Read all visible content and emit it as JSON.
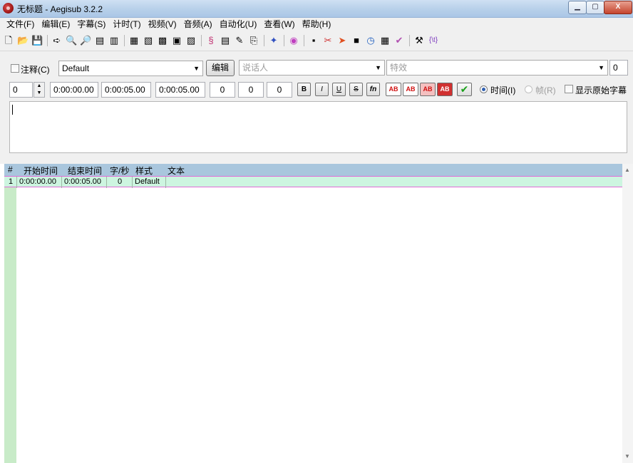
{
  "window": {
    "title": "无标题 - Aegisub 3.2.2",
    "min": "▁",
    "max": "▢",
    "close": "X"
  },
  "menu": [
    "文件(F)",
    "编辑(E)",
    "字幕(S)",
    "计时(T)",
    "视频(V)",
    "音频(A)",
    "自动化(U)",
    "查看(W)",
    "帮助(H)"
  ],
  "edit": {
    "comment_label": "注释(C)",
    "style": "Default",
    "edit_button": "编辑",
    "actor_placeholder": "说话人",
    "effect_placeholder": "特效",
    "layer": "0",
    "start": "0:00:00.00",
    "end": "0:00:05.00",
    "duration": "0:00:05.00",
    "margin_l": "0",
    "margin_r": "0",
    "margin_v": "0",
    "effect_num": "0",
    "bold": "B",
    "italic": "I",
    "underline": "U",
    "strike": "S",
    "fn": "fn",
    "ab1": "AB",
    "ab2": "AB",
    "ab3": "AB",
    "ab4": "AB",
    "time_radio": "时间(I)",
    "frame_radio": "帧(R)",
    "show_original": "显示原始字幕"
  },
  "grid": {
    "headers": [
      "#",
      "开始时间",
      "结束时间",
      "字/秒",
      "样式",
      "文本"
    ],
    "rows": [
      {
        "num": "1",
        "start": "0:00:00.00",
        "end": "0:00:05.00",
        "cps": "0",
        "style": "Default",
        "text": ""
      }
    ]
  },
  "colors": {
    "grid_header": "#a9c6dd",
    "row_bg": "#cdf5e0",
    "row_border": "#e06bd7"
  }
}
